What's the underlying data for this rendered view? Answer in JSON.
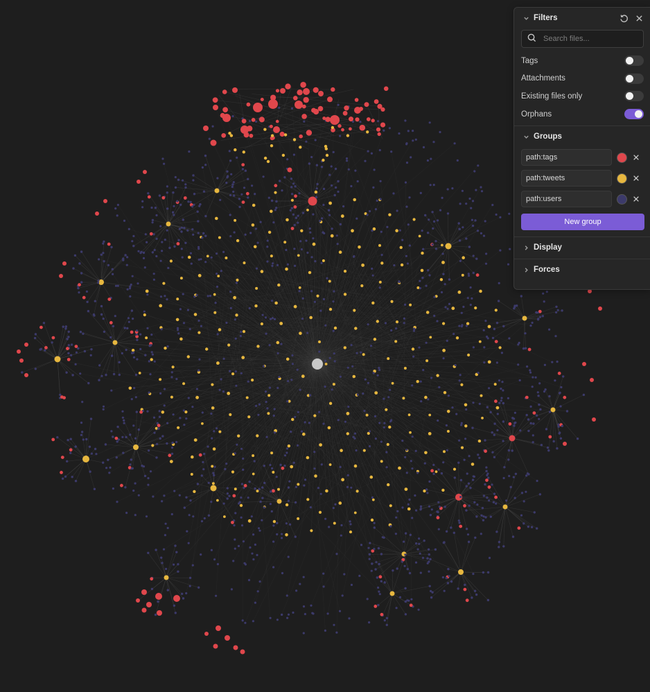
{
  "graph": {
    "colors": {
      "background": "#1e1e1e",
      "edge": "#565656",
      "tags": "#e0474c",
      "tweets": "#e7b73f",
      "users": "#3c3a6a",
      "center": "#c9c9c9"
    }
  },
  "filters": {
    "title": "Filters",
    "search_placeholder": "Search files...",
    "toggles": [
      {
        "label": "Tags",
        "on": false
      },
      {
        "label": "Attachments",
        "on": false
      },
      {
        "label": "Existing files only",
        "on": false
      },
      {
        "label": "Orphans",
        "on": true
      }
    ]
  },
  "groups": {
    "title": "Groups",
    "items": [
      {
        "query": "path:tags",
        "color": "#e0474c"
      },
      {
        "query": "path:tweets",
        "color": "#e7b73f"
      },
      {
        "query": "path:users",
        "color": "#3c3a6a"
      }
    ],
    "new_group_label": "New group"
  },
  "display": {
    "title": "Display"
  },
  "forces": {
    "title": "Forces"
  },
  "icons": {
    "reset": "reset-icon",
    "close": "close-icon",
    "search": "search-icon",
    "chevron_down": "chevron-down-icon",
    "chevron_right": "chevron-right-icon",
    "remove": "close-icon"
  }
}
